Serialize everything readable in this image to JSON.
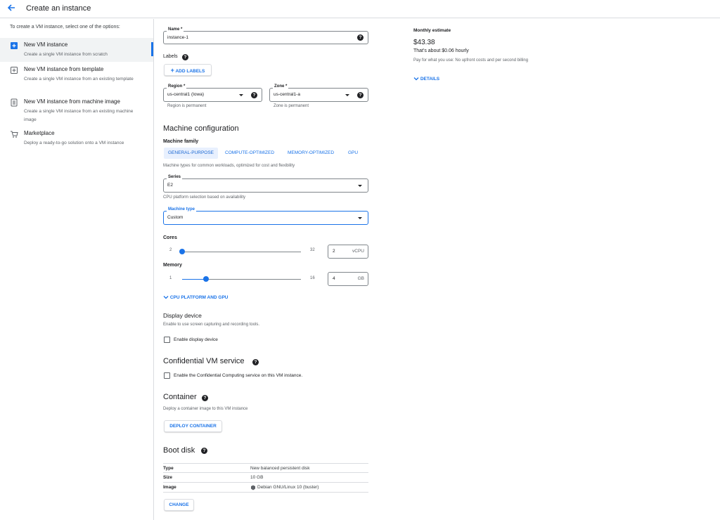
{
  "header": {
    "title": "Create an instance"
  },
  "sidebar": {
    "hint": "To create a VM instance, select one of the options:",
    "options": [
      {
        "title": "New VM instance",
        "desc": "Create a single VM instance from scratch",
        "icon": "add-box-icon"
      },
      {
        "title": "New VM instance from template",
        "desc": "Create a single VM instance from an existing template",
        "icon": "template-icon"
      },
      {
        "title": "New VM instance from machine image",
        "desc": "Create a single VM instance from an existing machine image",
        "icon": "machine-image-icon"
      },
      {
        "title": "Marketplace",
        "desc": "Deploy a ready-to-go solution onto a VM instance",
        "icon": "cart-icon"
      }
    ]
  },
  "form": {
    "name_label": "Name *",
    "name_value": "instance-1",
    "labels_label": "Labels",
    "add_labels": "ADD LABELS",
    "region_label": "Region *",
    "region_value": "us-central1 (Iowa)",
    "region_hint": "Region is permanent",
    "zone_label": "Zone *",
    "zone_value": "us-central1-a",
    "zone_hint": "Zone is permanent"
  },
  "machine": {
    "title": "Machine configuration",
    "family_label": "Machine family",
    "tabs": [
      "GENERAL-PURPOSE",
      "COMPUTE-OPTIMIZED",
      "MEMORY-OPTIMIZED",
      "GPU"
    ],
    "family_hint": "Machine types for common workloads, optimized for cost and flexibility",
    "series_label": "Series",
    "series_value": "E2",
    "series_hint": "CPU platform selection based on availability",
    "type_label": "Machine type",
    "type_value": "Custom",
    "cores_label": "Cores",
    "cores_min": "2",
    "cores_max": "32",
    "cores_value": "2",
    "cores_unit": "vCPU",
    "cores_fraction": 0.0,
    "memory_label": "Memory",
    "memory_min": "1",
    "memory_max": "16",
    "memory_value": "4",
    "memory_unit": "GB",
    "memory_fraction": 0.2,
    "cpu_platform_link": "CPU PLATFORM AND GPU"
  },
  "display": {
    "title": "Display device",
    "hint": "Enable to use screen capturing and recording tools.",
    "checkbox_label": "Enable display device"
  },
  "confidential": {
    "title": "Confidential VM service",
    "checkbox_label": "Enable the Confidential Computing service on this VM instance."
  },
  "container": {
    "title": "Container",
    "hint": "Deploy a container image to this VM instance",
    "button": "DEPLOY CONTAINER"
  },
  "boot_disk": {
    "title": "Boot disk",
    "rows": [
      {
        "key": "Type",
        "value": "New balanced persistent disk"
      },
      {
        "key": "Size",
        "value": "10 GB"
      },
      {
        "key": "Image",
        "value": "Debian GNU/Linux 10 (buster)"
      }
    ],
    "change_button": "CHANGE"
  },
  "estimate": {
    "label": "Monthly estimate",
    "price": "$43.38",
    "hourly": "That's about $0.06 hourly",
    "note": "Pay for what you use: No upfront costs and per second billing",
    "details_link": "DETAILS"
  },
  "colors": {
    "accent": "#1a73e8",
    "border": "#dadce0",
    "text": "#202124"
  }
}
